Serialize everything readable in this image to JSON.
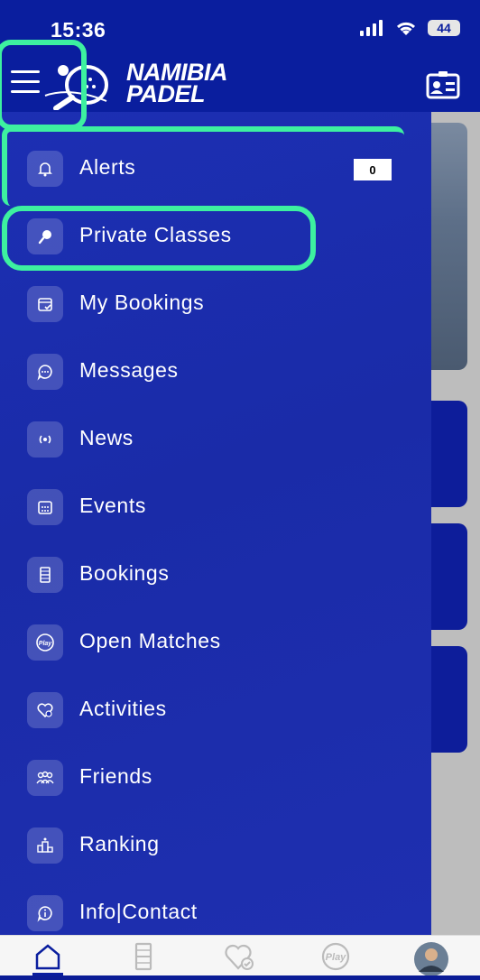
{
  "status": {
    "time": "15:36",
    "battery": "44"
  },
  "header": {
    "brand_line1": "NAMIBIA",
    "brand_line2": "PADEL"
  },
  "menu": {
    "items": [
      {
        "label": "Alerts",
        "icon": "bell-icon",
        "badge": "0"
      },
      {
        "label": "Private Classes",
        "icon": "padel-racket-icon"
      },
      {
        "label": "My Bookings",
        "icon": "calendar-check-icon"
      },
      {
        "label": "Messages",
        "icon": "chat-bubble-icon"
      },
      {
        "label": "News",
        "icon": "broadcast-icon"
      },
      {
        "label": "Events",
        "icon": "calendar-grid-icon"
      },
      {
        "label": "Bookings",
        "icon": "court-icon"
      },
      {
        "label": "Open Matches",
        "icon": "play-badge-icon"
      },
      {
        "label": "Activities",
        "icon": "heart-check-icon"
      },
      {
        "label": "Friends",
        "icon": "group-icon"
      },
      {
        "label": "Ranking",
        "icon": "podium-icon"
      },
      {
        "label": "Info|Contact",
        "icon": "info-chat-icon"
      }
    ]
  },
  "tabbar": {
    "items": [
      {
        "icon": "home-icon",
        "active": true
      },
      {
        "icon": "court-icon"
      },
      {
        "icon": "heart-check-icon"
      },
      {
        "icon": "play-badge-icon",
        "text": "Play"
      },
      {
        "icon": "profile-avatar"
      }
    ]
  },
  "colors": {
    "primary": "#0a1e9e",
    "drawer": "#1c2fb3",
    "annotation": "#3df0a0"
  }
}
